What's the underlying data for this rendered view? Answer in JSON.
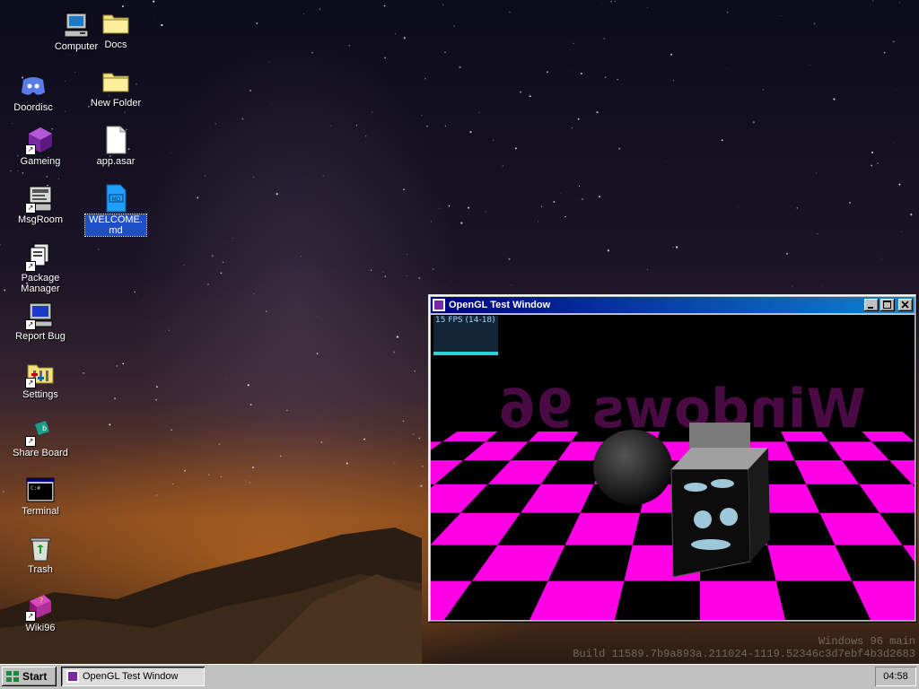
{
  "desktop": {
    "icons": [
      {
        "label": "Computer",
        "icon": "computer-icon"
      },
      {
        "label": "Docs",
        "icon": "folder-icon"
      },
      {
        "label": "Doordisc",
        "icon": "discord-icon"
      },
      {
        "label": "New Folder",
        "icon": "folder-icon"
      },
      {
        "label": "Gameing",
        "icon": "game-cube-icon"
      },
      {
        "label": "app.asar",
        "icon": "file-icon"
      },
      {
        "label": "MsgRoom",
        "icon": "msgroom-icon"
      },
      {
        "label": "WELCOME.md",
        "icon": "markdown-icon"
      },
      {
        "label": "Package Manager",
        "icon": "package-icon"
      },
      {
        "label": "Report Bug",
        "icon": "bug-report-icon"
      },
      {
        "label": "Settings",
        "icon": "settings-icon"
      },
      {
        "label": "Share Board",
        "icon": "share-icon"
      },
      {
        "label": "Terminal",
        "icon": "terminal-icon"
      },
      {
        "label": "Trash",
        "icon": "trash-icon"
      },
      {
        "label": "Wiki96",
        "icon": "wiki-book-icon"
      }
    ],
    "build": {
      "line1": "Windows 96 main",
      "line2": "Build 11589.7b9a893a.211024-1119.52346c3d7ebf4b3d2683"
    }
  },
  "window": {
    "title": "OpenGL Test Window",
    "fps": "15 FPS (14-18)",
    "scene_text": "Windows 96",
    "colors": {
      "floor_a": "#ff00e6",
      "floor_b": "#000000",
      "titlebar": "#000080"
    }
  },
  "taskbar": {
    "start_label": "Start",
    "task_label": "OpenGL Test Window",
    "clock": "04:58"
  }
}
